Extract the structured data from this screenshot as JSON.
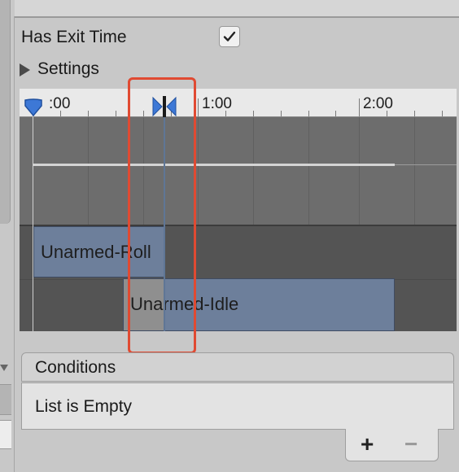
{
  "settings_panel": {
    "has_exit_time_label": "Has Exit Time",
    "has_exit_time_checked": true,
    "settings_foldout_label": "Settings",
    "settings_expanded": false
  },
  "timeline": {
    "ruler_labels": [
      ":00",
      "1:00",
      "2:00"
    ],
    "clips": [
      {
        "name": "Unarmed-Roll",
        "visible_text": "Unarmed-Roll"
      },
      {
        "name": "Unarmed-Idle",
        "visible_text": "Unarmed-Idle"
      }
    ],
    "clip_color": "#6d7f9b"
  },
  "conditions": {
    "title": "Conditions",
    "empty_text": "List is Empty",
    "add_label": "+",
    "remove_label": "−"
  },
  "annotation": {
    "highlight_color": "#e04a32"
  }
}
